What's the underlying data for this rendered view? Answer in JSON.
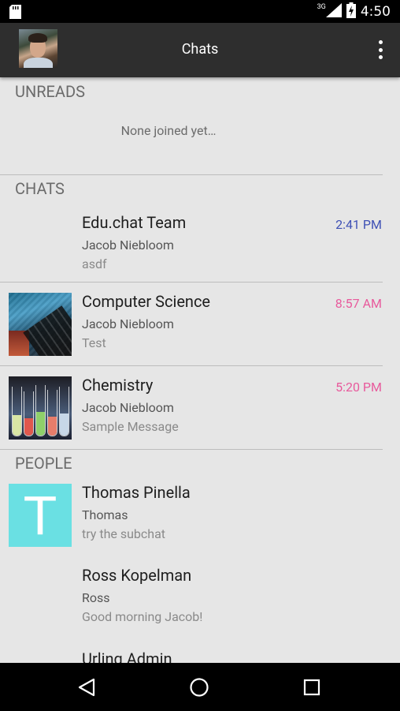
{
  "status_bar": {
    "network": "3G",
    "time": "4:50",
    "icons": [
      "sd-card-icon",
      "signal-icon",
      "battery-charging-icon"
    ]
  },
  "toolbar": {
    "title": "Chats",
    "avatar_icon": "user-avatar",
    "menu_icon": "overflow-menu-icon"
  },
  "unreads": {
    "header": "UNREADS",
    "empty_text": "None joined yet…"
  },
  "chats": {
    "header": "CHATS",
    "items": [
      {
        "name": "Edu.chat Team",
        "sender": "Jacob Niebloom",
        "message": "asdf",
        "time": "2:41 PM",
        "time_color": "#3f51b5",
        "thumb": "none"
      },
      {
        "name": "Computer Science",
        "sender": "Jacob Niebloom",
        "message": "Test",
        "time": "8:57 AM",
        "time_color": "#e85a9c",
        "thumb": "keyboard-image"
      },
      {
        "name": "Chemistry",
        "sender": "Jacob Niebloom",
        "message": "Sample Message",
        "time": "5:20 PM",
        "time_color": "#e85a9c",
        "thumb": "test-tubes-image"
      }
    ]
  },
  "people": {
    "header": "PEOPLE",
    "items": [
      {
        "name": "Thomas Pinella",
        "sender": "Thomas",
        "message": "try the subchat",
        "thumb_letter": "T",
        "thumb_color": "#6ae0e3"
      },
      {
        "name": "Ross Kopelman",
        "sender": "Ross",
        "message": "Good morning Jacob!"
      },
      {
        "name": "Urling Admin",
        "sender": "",
        "message": ""
      }
    ]
  },
  "nav_bar": {
    "icons": [
      "back-icon",
      "home-icon",
      "recents-icon"
    ]
  }
}
